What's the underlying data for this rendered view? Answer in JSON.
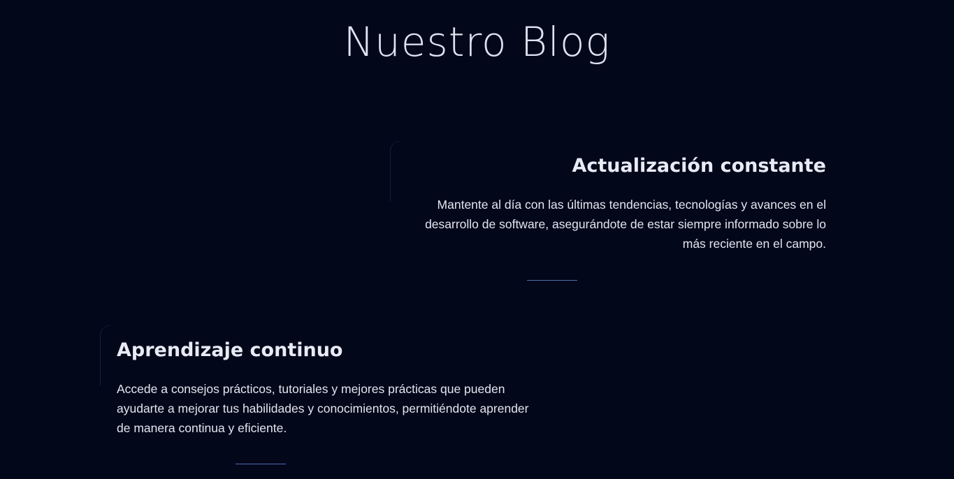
{
  "page": {
    "title": "Nuestro Blog"
  },
  "cards": [
    {
      "title": "Actualización constante",
      "description": "Mantente al día con las últimas tendencias, tecnologías y avances en el desarrollo de software, asegurándote de estar siempre informado sobre lo más reciente en el campo."
    },
    {
      "title": "Aprendizaje continuo",
      "description": "Accede a consejos prácticos, tutoriales y mejores prácticas que pueden ayudarte a mejorar tus habilidades y conocimientos, permitiéndote aprender de manera continua y eficiente."
    }
  ],
  "colors": {
    "background": "#03071a",
    "text": "#e6e9f2",
    "accent_line": "#4a6fb0"
  }
}
